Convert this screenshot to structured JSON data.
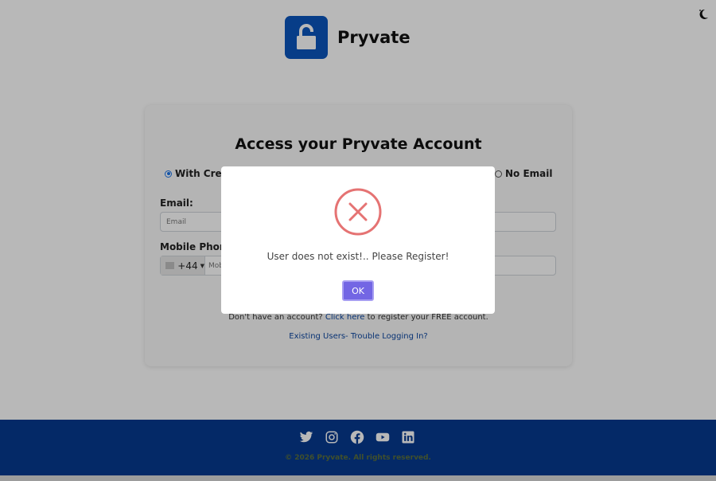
{
  "brand": {
    "name": "Pryvate",
    "logo_icon": "padlock-icon",
    "logo_color": "#0b55bd"
  },
  "header": {
    "theme_toggle_icon": "moon-icon"
  },
  "login_card": {
    "title": "Access your Pryvate Account",
    "options": [
      {
        "label": "With Crede",
        "selected": true
      },
      {
        "label": "No Email",
        "selected": false
      }
    ],
    "email_label": "Email:",
    "email_placeholder": "Email",
    "mobile_label": "Mobile Phone:",
    "country_code": "+44",
    "mobile_placeholder": "Mob",
    "register_prefix": "Don't have an account?",
    "register_link": "Click here",
    "register_suffix": "to register your FREE account.",
    "trouble_link": "Existing Users- Trouble Logging In?"
  },
  "modal": {
    "icon": "error-x-icon",
    "message": "User does not exist!.. Please Register!",
    "ok_label": "OK",
    "ok_color": "#7366e4",
    "error_color": "#e57373"
  },
  "footer": {
    "socials": [
      "twitter-icon",
      "instagram-icon",
      "facebook-icon",
      "youtube-icon",
      "linkedin-icon"
    ],
    "copyright": "© 2026 Pryvate. All rights reserved.",
    "background": "#063a8f"
  }
}
